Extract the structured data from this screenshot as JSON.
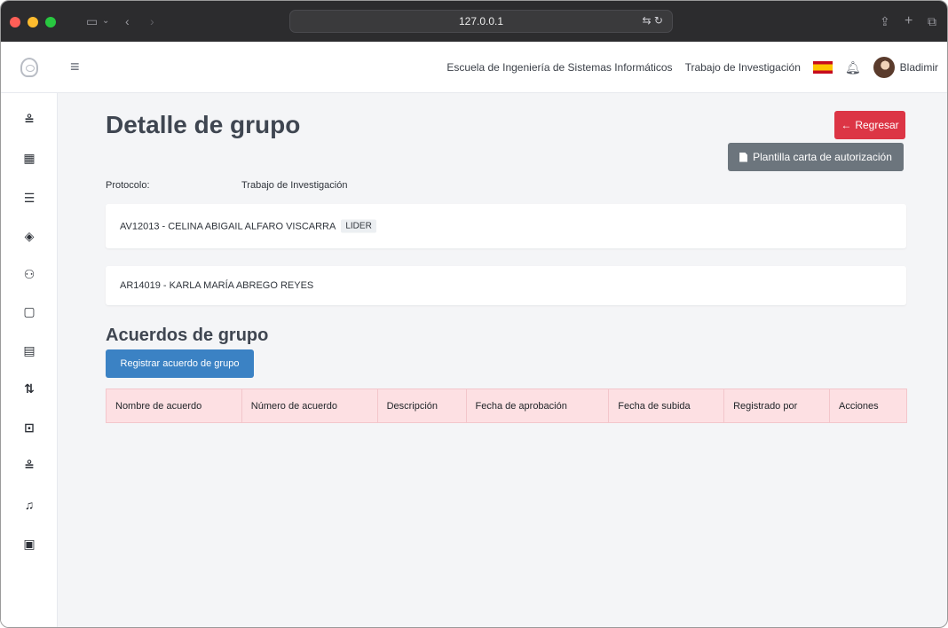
{
  "browser": {
    "address": "127.0.0.1"
  },
  "header": {
    "school_link": "Escuela de Ingeniería de Sistemas Informáticos",
    "research_link": "Trabajo de Investigación",
    "user_name": "Bladimir"
  },
  "sidebar": {
    "icons": [
      "users-list-icon",
      "building-icon",
      "books-icon",
      "diamond-icon",
      "group-icon",
      "file-icon",
      "file-text-icon",
      "git-icon",
      "code-window-icon",
      "users-list-icon",
      "bell-icon",
      "calendar-icon"
    ]
  },
  "page": {
    "title": "Detalle de grupo",
    "back_button": "Regresar",
    "template_button": "Plantilla carta de autorización",
    "protocolo_label": "Protocolo:",
    "protocolo_value": "Trabajo de Investigación"
  },
  "members": [
    {
      "text": "AV12013 - CELINA ABIGAIL ALFARO VISCARRA",
      "badge": "LIDER"
    },
    {
      "text": "AR14019 - KARLA MARÍA ABREGO REYES",
      "badge": ""
    }
  ],
  "agreements": {
    "title": "Acuerdos de grupo",
    "register_button": "Registrar acuerdo de grupo",
    "columns": [
      "Nombre de acuerdo",
      "Número de acuerdo",
      "Descripción",
      "Fecha de aprobación",
      "Fecha de subida",
      "Registrado por",
      "Acciones"
    ]
  },
  "colors": {
    "danger": "#dc3545",
    "secondary": "#6c757d",
    "primary": "#3b82c4",
    "table_header": "#fde0e3"
  }
}
